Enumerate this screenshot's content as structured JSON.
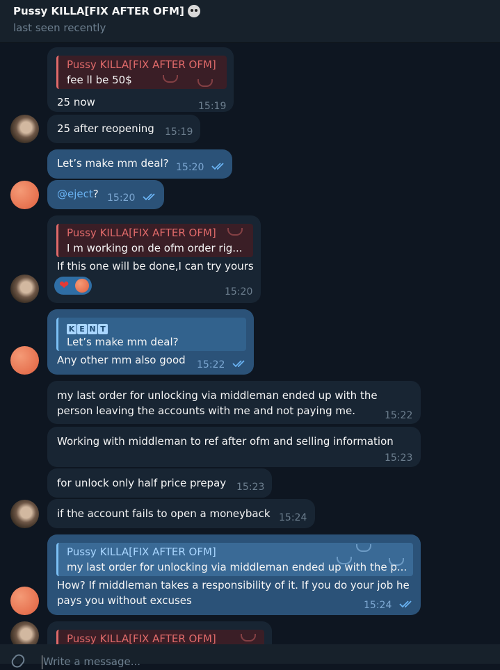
{
  "header": {
    "title": "Pussy KILLA[FIX AFTER OFM]",
    "status": "last seen recently"
  },
  "messages": [
    {
      "reply_name": "Pussy KILLA[FIX AFTER OFM]",
      "reply_text": "fee ll be 50$",
      "text": "25 now",
      "time": "15:19"
    },
    {
      "text": "25 after reopening",
      "time": "15:19"
    },
    {
      "text": "Let’s make mm deal?",
      "time": "15:20"
    },
    {
      "mention": "@eject",
      "text": "?",
      "time": "15:20"
    },
    {
      "reply_name": "Pussy KILLA[FIX AFTER OFM]",
      "reply_text": "I m working on de ofm order rig...",
      "text": "If this one will be done,I can try yours",
      "time": "15:20",
      "reaction": "❤"
    },
    {
      "reply_name_letters": [
        "K",
        "E",
        "N",
        "T"
      ],
      "reply_text": "Let’s make mm deal?",
      "text": "Any other mm also good",
      "time": "15:22"
    },
    {
      "line1": "my last order for unlocking via middleman ended up with the",
      "line2": "person leaving the accounts with me and not paying me.",
      "time": "15:22"
    },
    {
      "text": "Working with middleman to ref after ofm and selling information",
      "time": "15:23"
    },
    {
      "text": "for unlock only half price prepay",
      "time": "15:23"
    },
    {
      "text": "if the account fails to open a moneyback",
      "time": "15:24"
    },
    {
      "reply_name": "Pussy KILLA[FIX AFTER OFM]",
      "reply_text": "my last order for unlocking via middleman ended up with the p...",
      "line1": "How? If middleman takes a responsibility of it. If you do your job he",
      "line2": "pays you without excuses",
      "time": "15:24"
    },
    {
      "reply_name": "Pussy KILLA[FIX AFTER OFM]"
    }
  ],
  "composer": {
    "placeholder": "Write a message..."
  },
  "colors": {
    "bg": "#0e1621",
    "incoming": "#182533",
    "outgoing": "#2b5278",
    "accent": "#6ab3f3",
    "reply_red": "#e06a6a"
  }
}
